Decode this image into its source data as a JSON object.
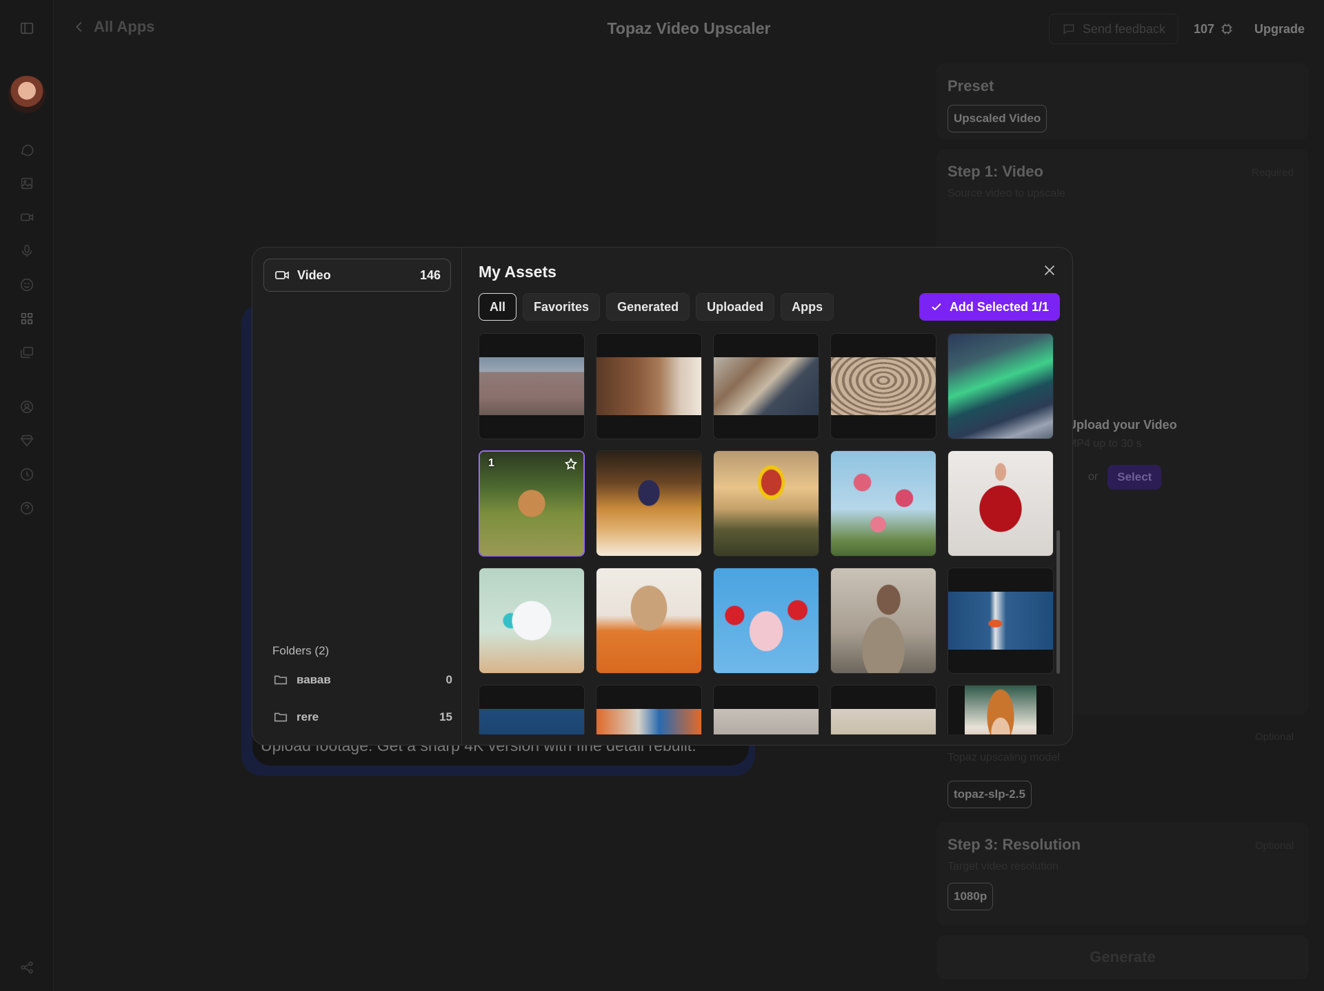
{
  "app": {
    "back_label": "All Apps",
    "title": "Topaz Video Upscaler",
    "feedback_label": "Send feedback",
    "credits": "107",
    "upgrade_label": "Upgrade"
  },
  "panel": {
    "preset_title": "Preset",
    "preset_value": "Upscaled Video",
    "step1_title": "Step 1: Video",
    "step1_sub": "Source video to upscale",
    "step1_required": "Required",
    "upload_title": "Upload your Video",
    "upload_sub": "MP4 up to 30 s",
    "upload_or": "or",
    "upload_select": "Select",
    "step2_optional": "Optional",
    "step2_sub": "Topaz upscaling model",
    "step2_value": "topaz-slp-2.5",
    "step3_title": "Step 3: Resolution",
    "step3_optional": "Optional",
    "step3_sub": "Target video resolution",
    "step3_value": "1080p",
    "generate_label": "Generate"
  },
  "background_card": {
    "description": "Upload footage. Get a sharp 4K version with fine detail rebuilt."
  },
  "modal": {
    "sidebar": {
      "video_label": "Video",
      "video_count": "146",
      "folders_title": "Folders (2)",
      "folders": [
        {
          "name": "вавав",
          "count": "0"
        },
        {
          "name": "rere",
          "count": "15"
        }
      ]
    },
    "title": "My Assets",
    "tabs": [
      "All",
      "Favorites",
      "Generated",
      "Uploaded",
      "Apps"
    ],
    "active_tab": "All",
    "add_selected_label": "Add Selected 1/1",
    "selected_badge": "1",
    "accent_color": "#7b22f5"
  },
  "rail_icons": [
    "panel-toggle-icon",
    "avatar",
    "chat-icon",
    "image-icon",
    "video-icon",
    "mic-icon",
    "face-icon",
    "apps-grid-icon",
    "library-icon",
    "user-circle-icon",
    "diamond-icon",
    "history-icon",
    "help-icon",
    "share-icon"
  ]
}
